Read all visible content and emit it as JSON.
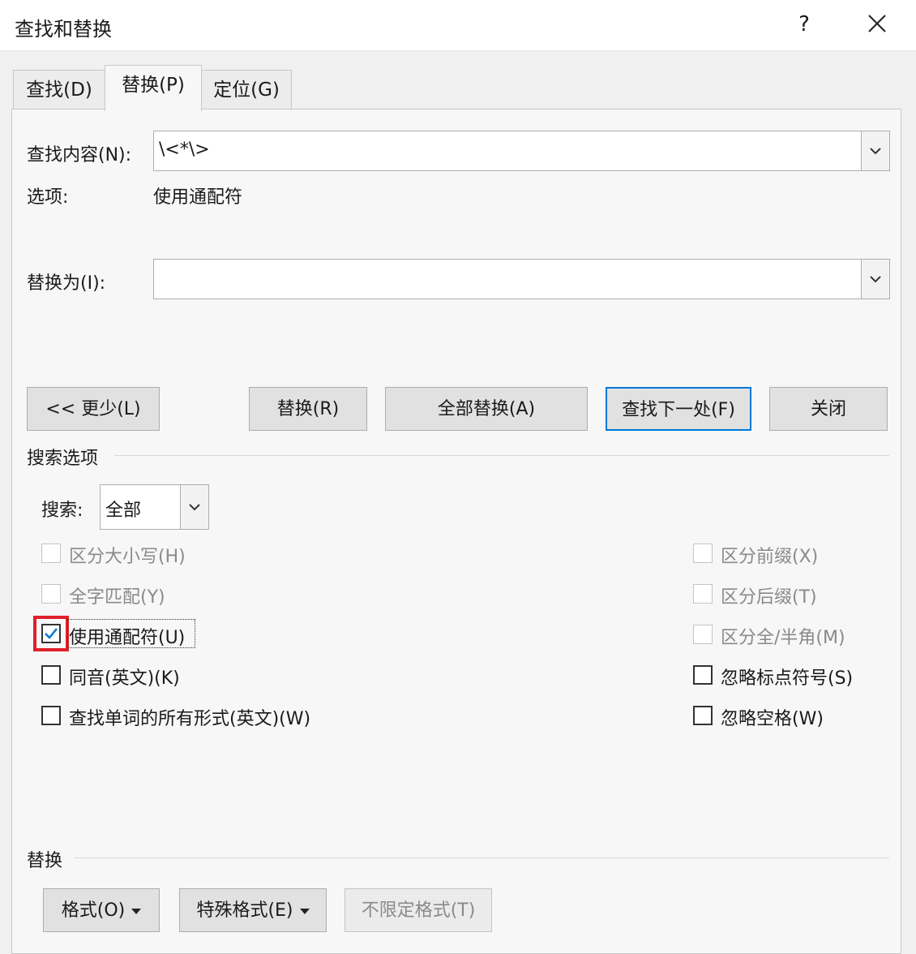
{
  "window": {
    "title": "查找和替换",
    "help": "?"
  },
  "tabs": [
    {
      "label": "查找(D)"
    },
    {
      "label": "替换(P)"
    },
    {
      "label": "定位(G)"
    }
  ],
  "find": {
    "label": "查找内容(N):",
    "value": "\\<*\\>"
  },
  "options_row": {
    "label": "选项:",
    "value": "使用通配符"
  },
  "replace": {
    "label": "替换为(I):",
    "value": ""
  },
  "buttons": {
    "less": "<< 更少(L)",
    "replace": "替换(R)",
    "replace_all": "全部替换(A)",
    "find_next": "查找下一处(F)",
    "close": "关闭"
  },
  "search_options": {
    "title": "搜索选项",
    "search_label": "搜索:",
    "search_value": "全部",
    "left": [
      {
        "label": "区分大小写(H)",
        "checked": false,
        "enabled": false
      },
      {
        "label": "全字匹配(Y)",
        "checked": false,
        "enabled": false
      },
      {
        "label": "使用通配符(U)",
        "checked": true,
        "enabled": true
      },
      {
        "label": "同音(英文)(K)",
        "checked": false,
        "enabled": true
      },
      {
        "label": "查找单词的所有形式(英文)(W)",
        "checked": false,
        "enabled": true
      }
    ],
    "right": [
      {
        "label": "区分前缀(X)",
        "checked": false,
        "enabled": false
      },
      {
        "label": "区分后缀(T)",
        "checked": false,
        "enabled": false
      },
      {
        "label": "区分全/半角(M)",
        "checked": false,
        "enabled": false
      },
      {
        "label": "忽略标点符号(S)",
        "checked": false,
        "enabled": true
      },
      {
        "label": "忽略空格(W)",
        "checked": false,
        "enabled": true
      }
    ]
  },
  "replace_section": {
    "title": "替换",
    "format": "格式(O)",
    "special": "特殊格式(E)",
    "no_format": "不限定格式(T)"
  },
  "colors": {
    "accent": "#0078d7",
    "highlight": "#e0202b"
  }
}
